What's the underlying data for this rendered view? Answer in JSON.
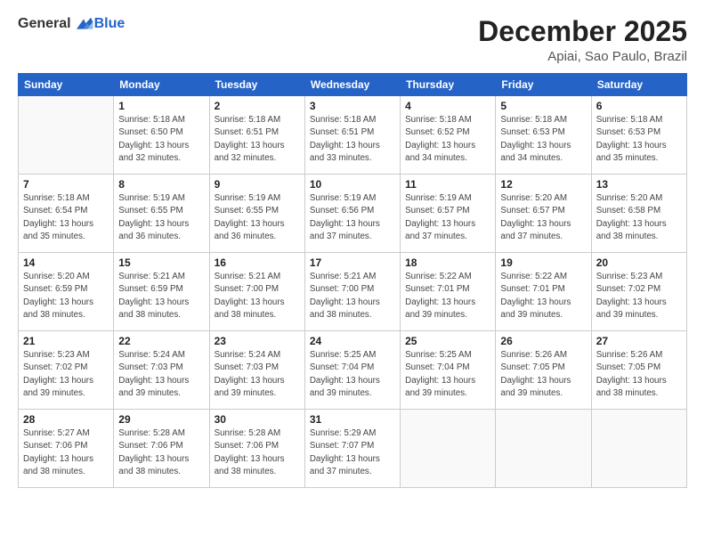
{
  "logo": {
    "general": "General",
    "blue": "Blue"
  },
  "header": {
    "month": "December 2025",
    "location": "Apiai, Sao Paulo, Brazil"
  },
  "weekdays": [
    "Sunday",
    "Monday",
    "Tuesday",
    "Wednesday",
    "Thursday",
    "Friday",
    "Saturday"
  ],
  "weeks": [
    [
      {
        "day": "",
        "info": ""
      },
      {
        "day": "1",
        "info": "Sunrise: 5:18 AM\nSunset: 6:50 PM\nDaylight: 13 hours\nand 32 minutes."
      },
      {
        "day": "2",
        "info": "Sunrise: 5:18 AM\nSunset: 6:51 PM\nDaylight: 13 hours\nand 32 minutes."
      },
      {
        "day": "3",
        "info": "Sunrise: 5:18 AM\nSunset: 6:51 PM\nDaylight: 13 hours\nand 33 minutes."
      },
      {
        "day": "4",
        "info": "Sunrise: 5:18 AM\nSunset: 6:52 PM\nDaylight: 13 hours\nand 34 minutes."
      },
      {
        "day": "5",
        "info": "Sunrise: 5:18 AM\nSunset: 6:53 PM\nDaylight: 13 hours\nand 34 minutes."
      },
      {
        "day": "6",
        "info": "Sunrise: 5:18 AM\nSunset: 6:53 PM\nDaylight: 13 hours\nand 35 minutes."
      }
    ],
    [
      {
        "day": "7",
        "info": "Sunrise: 5:18 AM\nSunset: 6:54 PM\nDaylight: 13 hours\nand 35 minutes."
      },
      {
        "day": "8",
        "info": "Sunrise: 5:19 AM\nSunset: 6:55 PM\nDaylight: 13 hours\nand 36 minutes."
      },
      {
        "day": "9",
        "info": "Sunrise: 5:19 AM\nSunset: 6:55 PM\nDaylight: 13 hours\nand 36 minutes."
      },
      {
        "day": "10",
        "info": "Sunrise: 5:19 AM\nSunset: 6:56 PM\nDaylight: 13 hours\nand 37 minutes."
      },
      {
        "day": "11",
        "info": "Sunrise: 5:19 AM\nSunset: 6:57 PM\nDaylight: 13 hours\nand 37 minutes."
      },
      {
        "day": "12",
        "info": "Sunrise: 5:20 AM\nSunset: 6:57 PM\nDaylight: 13 hours\nand 37 minutes."
      },
      {
        "day": "13",
        "info": "Sunrise: 5:20 AM\nSunset: 6:58 PM\nDaylight: 13 hours\nand 38 minutes."
      }
    ],
    [
      {
        "day": "14",
        "info": "Sunrise: 5:20 AM\nSunset: 6:59 PM\nDaylight: 13 hours\nand 38 minutes."
      },
      {
        "day": "15",
        "info": "Sunrise: 5:21 AM\nSunset: 6:59 PM\nDaylight: 13 hours\nand 38 minutes."
      },
      {
        "day": "16",
        "info": "Sunrise: 5:21 AM\nSunset: 7:00 PM\nDaylight: 13 hours\nand 38 minutes."
      },
      {
        "day": "17",
        "info": "Sunrise: 5:21 AM\nSunset: 7:00 PM\nDaylight: 13 hours\nand 38 minutes."
      },
      {
        "day": "18",
        "info": "Sunrise: 5:22 AM\nSunset: 7:01 PM\nDaylight: 13 hours\nand 39 minutes."
      },
      {
        "day": "19",
        "info": "Sunrise: 5:22 AM\nSunset: 7:01 PM\nDaylight: 13 hours\nand 39 minutes."
      },
      {
        "day": "20",
        "info": "Sunrise: 5:23 AM\nSunset: 7:02 PM\nDaylight: 13 hours\nand 39 minutes."
      }
    ],
    [
      {
        "day": "21",
        "info": "Sunrise: 5:23 AM\nSunset: 7:02 PM\nDaylight: 13 hours\nand 39 minutes."
      },
      {
        "day": "22",
        "info": "Sunrise: 5:24 AM\nSunset: 7:03 PM\nDaylight: 13 hours\nand 39 minutes."
      },
      {
        "day": "23",
        "info": "Sunrise: 5:24 AM\nSunset: 7:03 PM\nDaylight: 13 hours\nand 39 minutes."
      },
      {
        "day": "24",
        "info": "Sunrise: 5:25 AM\nSunset: 7:04 PM\nDaylight: 13 hours\nand 39 minutes."
      },
      {
        "day": "25",
        "info": "Sunrise: 5:25 AM\nSunset: 7:04 PM\nDaylight: 13 hours\nand 39 minutes."
      },
      {
        "day": "26",
        "info": "Sunrise: 5:26 AM\nSunset: 7:05 PM\nDaylight: 13 hours\nand 39 minutes."
      },
      {
        "day": "27",
        "info": "Sunrise: 5:26 AM\nSunset: 7:05 PM\nDaylight: 13 hours\nand 38 minutes."
      }
    ],
    [
      {
        "day": "28",
        "info": "Sunrise: 5:27 AM\nSunset: 7:06 PM\nDaylight: 13 hours\nand 38 minutes."
      },
      {
        "day": "29",
        "info": "Sunrise: 5:28 AM\nSunset: 7:06 PM\nDaylight: 13 hours\nand 38 minutes."
      },
      {
        "day": "30",
        "info": "Sunrise: 5:28 AM\nSunset: 7:06 PM\nDaylight: 13 hours\nand 38 minutes."
      },
      {
        "day": "31",
        "info": "Sunrise: 5:29 AM\nSunset: 7:07 PM\nDaylight: 13 hours\nand 37 minutes."
      },
      {
        "day": "",
        "info": ""
      },
      {
        "day": "",
        "info": ""
      },
      {
        "day": "",
        "info": ""
      }
    ]
  ]
}
